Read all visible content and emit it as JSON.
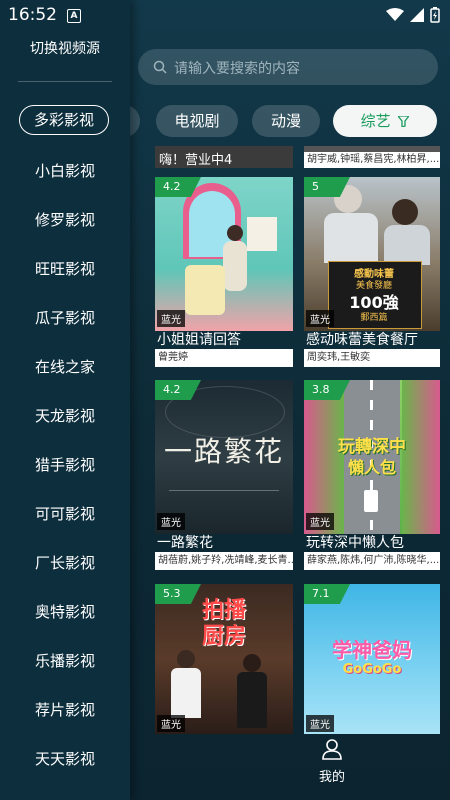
{
  "status": {
    "time": "16:52",
    "notification_icon": "a-icon"
  },
  "search": {
    "placeholder": "请输入要搜索的内容"
  },
  "tabs": [
    {
      "label": "电视剧"
    },
    {
      "label": "动漫"
    },
    {
      "label": "综艺",
      "active": true,
      "icon": "filter-icon"
    }
  ],
  "drawer": {
    "title": "切换视频源",
    "items": [
      "多彩影视",
      "小白影视",
      "修罗影视",
      "旺旺影视",
      "瓜子影视",
      "在线之家",
      "天龙影视",
      "猎手影视",
      "可可影视",
      "厂长影视",
      "奥特影视",
      "乐播影视",
      "荐片影视",
      "天天影视"
    ],
    "selected": "多彩影视"
  },
  "top_partial": {
    "title": "嗨！营业中4",
    "sub": "胡宇威,钟瑶,蔡昌宪,林柏昇,..."
  },
  "cards": [
    {
      "rating": "4.2",
      "quality": "蓝光",
      "title": "小姐姐请回答",
      "sub": "曾莞婷"
    },
    {
      "rating": "5",
      "quality": "蓝光",
      "title": "感动味蕾美食餐厅",
      "sub": "周奕玮,王敏奕",
      "poster_text": [
        "感動味蕾",
        "美食發廳",
        "100強",
        "郵西篇"
      ]
    },
    {
      "rating": "4.2",
      "quality": "蓝光",
      "title": "一路繁花",
      "sub": "胡蓓蔚,姚子羚,冼靖峰,麦长青...",
      "poster_text": "一路繁花"
    },
    {
      "rating": "3.8",
      "quality": "蓝光",
      "title": "玩转深中懒人包",
      "sub": "薛家燕,陈炜,何广沛,陈晓华,...",
      "poster_text": [
        "玩轉深中",
        "懶人包"
      ]
    },
    {
      "rating": "5.3",
      "quality": "蓝光",
      "poster_text": [
        "拍播",
        "厨房"
      ]
    },
    {
      "rating": "7.1",
      "quality": "蓝光",
      "poster_text": [
        "学神爸妈",
        "GoGoGo"
      ]
    }
  ],
  "bottom_nav": {
    "label": "我的",
    "icon": "person-icon"
  },
  "colors": {
    "accent": "#1f9c4c",
    "active_tab_text": "#1a9c5d",
    "drawer_bg": "#0d2e3d"
  }
}
